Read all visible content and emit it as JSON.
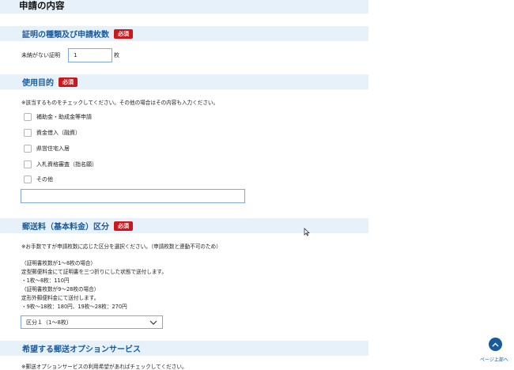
{
  "page": {
    "title": "申請の内容"
  },
  "cert_section": {
    "title": "証明の種類及び申請枚数",
    "required_badge": "必須",
    "field_label": "未納がない証明",
    "field_value": "1",
    "unit": "枚"
  },
  "purpose_section": {
    "title": "使用目的",
    "required_badge": "必須",
    "instruction": "※該当するものをチェックしてください。その他の場合はその内容も入力ください。",
    "options": [
      "補助金・助成金等申請",
      "資金借入（融資）",
      "県営住宅入居",
      "入札資格審査（指名願）",
      "その他"
    ],
    "other_input_value": ""
  },
  "postage_section": {
    "title": "郵送料（基本料金）区分",
    "required_badge": "必須",
    "instruction": "※お手数ですが申請枚数に応じた区分を選択ください。（申請枚数と連動不可のため）",
    "info_lines": [
      "（証明書枚数が1～8枚の場合）",
      "定型郵便料金にて証明書を三つ折りにした状態で送付します。",
      "・1枚～8枚：110円",
      "（証明書枚数が9～28枚の場合）",
      "定形外郵便料金にて送付します。",
      "・9枚～18枚：180円、19枚～28枚：270円"
    ],
    "select_value": "区分１（1～8枚）"
  },
  "option_section": {
    "title": "希望する郵送オプションサービス",
    "instruction": "※郵送オプションサービスの利用希望があればチェックしてください。"
  },
  "back_to_top": {
    "label": "ページ上部へ"
  },
  "colors": {
    "accent": "#1a5a9c",
    "header_bg": "#e6f1fa",
    "required": "#c8191d"
  }
}
